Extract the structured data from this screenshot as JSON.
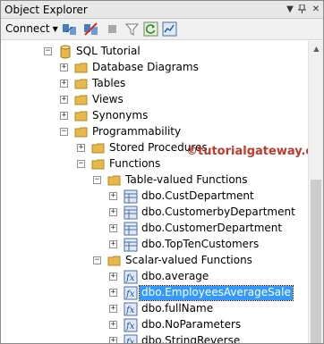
{
  "window": {
    "title": "Object Explorer"
  },
  "toolbar": {
    "connect_label": "Connect"
  },
  "tree": {
    "database": "SQL Tutorial",
    "items": {
      "database_diagrams": "Database Diagrams",
      "tables": "Tables",
      "views": "Views",
      "synonyms": "Synonyms",
      "programmability": "Programmability",
      "stored_procedures": "Stored Procedures",
      "functions": "Functions",
      "table_valued": "Table-valued Functions",
      "scalar_valued": "Scalar-valued Functions"
    },
    "table_valued_functions": [
      "dbo.CustDepartment",
      "dbo.CustomerbyDepartment",
      "dbo.CustomerDepartment",
      "dbo.TopTenCustomers"
    ],
    "scalar_valued_functions": [
      "dbo.average",
      "dbo.EmployeesAverageSale",
      "dbo.fullName",
      "dbo.NoParameters",
      "dbo.StringReverse"
    ]
  },
  "watermark": "©tutorialgateway.org",
  "colors": {
    "selection": "#3399ff",
    "folder": "#e8b84b",
    "watermark": "#c0392b"
  },
  "icons": {
    "database": "database-cylinder-icon",
    "folder": "folder-icon",
    "table_function": "table-function-icon",
    "scalar_function": "scalar-function-icon"
  }
}
